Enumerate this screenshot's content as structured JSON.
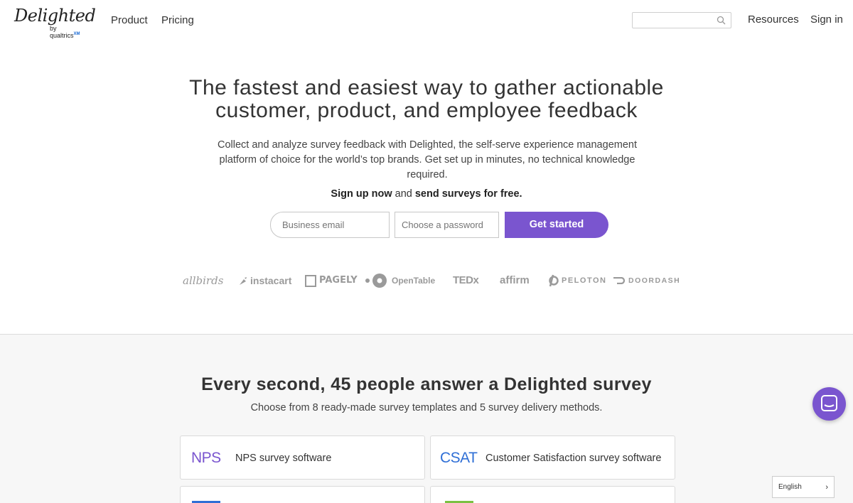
{
  "brand": {
    "name": "Delighted",
    "sub": "by qualtrics",
    "accent": "#7a55cf"
  },
  "nav": {
    "product": "Product",
    "pricing": "Pricing",
    "resources": "Resources",
    "sign_in": "Sign in",
    "search_placeholder": ""
  },
  "hero": {
    "title_line1": "The fastest and easiest way to gather actionable",
    "title_line2": "customer, product, and employee feedback",
    "subtitle": "Collect and analyze survey feedback with Delighted, the self-serve experience management platform of choice for the world’s top brands. Get set up in minutes, no technical knowledge required.",
    "cta_a": "Sign up now",
    "cta_b": " and ",
    "cta_c": "send surveys for free.",
    "email_placeholder": "Business email",
    "password_placeholder": "Choose a password",
    "button": "Get started"
  },
  "customer_logos": [
    "allbirds",
    "instacart",
    "PAGELY",
    "OpenTable",
    "TEDx",
    "affirm",
    "PELOTON",
    "DOORDASH"
  ],
  "section2": {
    "title_bold": "Every second,",
    "title_rest": " 45 people answer a Delighted survey",
    "subtitle": "Choose from 8 ready-made survey templates and 5 survey delivery methods.",
    "cards": [
      {
        "abbr": "NPS",
        "label": "NPS survey software",
        "color": "#7a55cf"
      },
      {
        "abbr": "CSAT",
        "label": "Customer Satisfaction survey software",
        "color": "#2f6fd6"
      }
    ]
  },
  "language": "English"
}
